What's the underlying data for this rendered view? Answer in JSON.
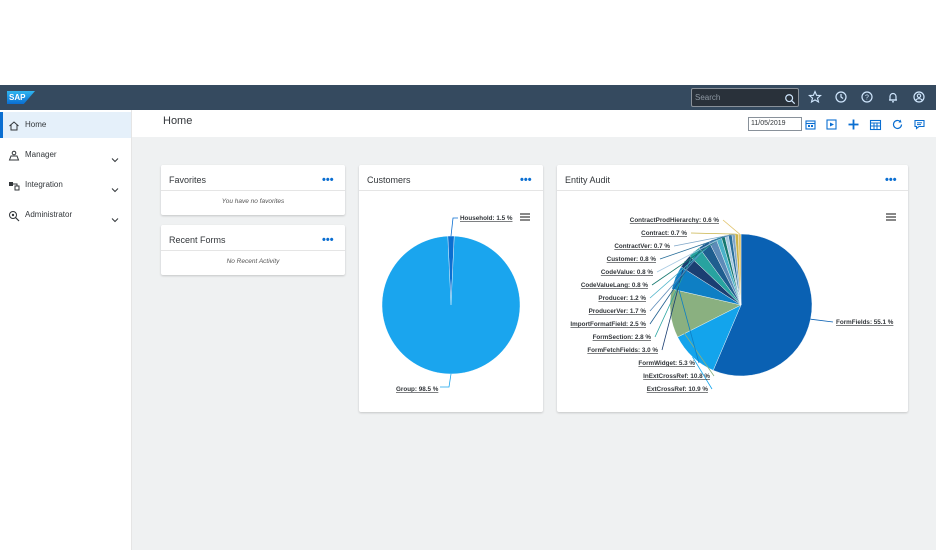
{
  "shell": {
    "logo_text": "SAP",
    "search_placeholder": "Search",
    "icons": [
      "search-icon",
      "star-icon",
      "history-icon",
      "help-icon",
      "bell-icon",
      "user-icon"
    ]
  },
  "sidenav": {
    "items": [
      {
        "label": "Home",
        "icon": "home-icon",
        "active": true,
        "expandable": false
      },
      {
        "label": "Manager",
        "icon": "manager-icon",
        "active": false,
        "expandable": true
      },
      {
        "label": "Integration",
        "icon": "integration-icon",
        "active": false,
        "expandable": true
      },
      {
        "label": "Administrator",
        "icon": "admin-icon",
        "active": false,
        "expandable": true
      }
    ]
  },
  "page": {
    "title": "Home",
    "date": "11/05/2019",
    "toolbar_icons": [
      "calendar-icon",
      "play-icon",
      "add-icon",
      "grid-calendar-icon",
      "refresh-icon",
      "comment-icon"
    ]
  },
  "favorites": {
    "title": "Favorites",
    "more": "•••",
    "empty_text": "You have no favorites"
  },
  "recent_forms": {
    "title": "Recent Forms",
    "more": "•••",
    "empty_text": "No Recent Activity"
  },
  "customers": {
    "title": "Customers",
    "more": "•••"
  },
  "entity_audit": {
    "title": "Entity Audit",
    "more": "•••"
  },
  "chart_data": [
    {
      "type": "pie",
      "title": "",
      "categories": [
        "Household",
        "Group"
      ],
      "values": [
        1.5,
        98.5
      ],
      "labels": [
        "Household: 1.5 %",
        "Group: 98.5 %"
      ],
      "colors": [
        "#0a6ed1",
        "#1aa5ee"
      ]
    },
    {
      "type": "pie",
      "title": "",
      "categories": [
        "FormFields",
        "ExtCrossRef",
        "InExtCrossRef",
        "FormWidget",
        "FormFetchFields",
        "FormSection",
        "ImportFormatField",
        "ProducerVer",
        "Producer",
        "CodeValueLang",
        "CodeValue",
        "Customer",
        "ContractVer",
        "Contract",
        "ContractProdHierarchy"
      ],
      "values": [
        55.1,
        10.9,
        10.8,
        5.3,
        3.0,
        2.8,
        2.5,
        1.7,
        1.2,
        0.8,
        0.8,
        0.8,
        0.7,
        0.7,
        0.6
      ],
      "labels": [
        "FormFields: 55.1 %",
        "ExtCrossRef: 10.9 %",
        "InExtCrossRef: 10.8 %",
        "FormWidget: 5.3 %",
        "FormFetchFields: 3.0 %",
        "FormSection: 2.8 %",
        "ImportFormatField: 2.5 %",
        "ProducerVer: 1.7 %",
        "Producer: 1.2 %",
        "CodeValueLang: 0.8 %",
        "CodeValue: 0.8 %",
        "Customer: 0.8 %",
        "ContractVer: 0.7 %",
        "Contract: 0.7 %",
        "ContractProdHierarchy: 0.6 %"
      ],
      "colors": [
        "#0a61b3",
        "#13a4ec",
        "#8ab080",
        "#0e7fc4",
        "#1b3f72",
        "#28a3a0",
        "#1f5e8f",
        "#5d8bb8",
        "#4cb3c9",
        "#16786f",
        "#a6c9e2",
        "#2a6f9a",
        "#7fa6c8",
        "#c9b34a",
        "#e1c36a"
      ]
    }
  ]
}
